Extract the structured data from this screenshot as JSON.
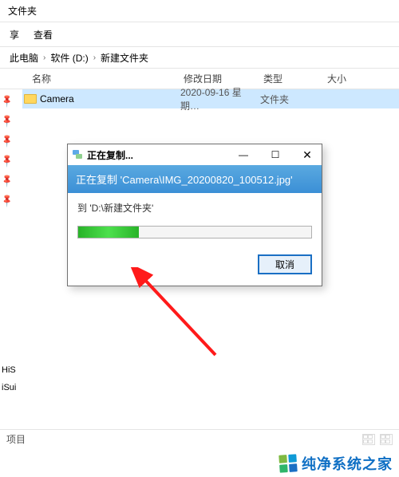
{
  "window": {
    "title_suffix": "文件夹"
  },
  "toolbar": {
    "share": "享",
    "view": "查看"
  },
  "breadcrumb": {
    "root": "此电脑",
    "drive": "软件 (D:)",
    "folder": "新建文件夹",
    "chev": "›"
  },
  "headers": {
    "name": "名称",
    "date": "修改日期",
    "type": "类型",
    "size": "大小"
  },
  "rows": [
    {
      "name": "Camera",
      "date": "2020-09-16 星期…",
      "type": "文件夹"
    }
  ],
  "dialog": {
    "title": "正在复制...",
    "banner_prefix": "正在复制 ",
    "banner_file": "'Camera\\IMG_20200820_100512.jpg'",
    "dest_prefix": "到 ",
    "dest_path": "'D:\\新建文件夹'",
    "cancel": "取消",
    "minimize": "—",
    "maximize": "☐",
    "close": "✕",
    "progress_percent": 26
  },
  "bottom": {
    "a": "HiS",
    "b": "iSui",
    "status": "项目"
  },
  "watermark": {
    "text": "纯净系统之家"
  }
}
